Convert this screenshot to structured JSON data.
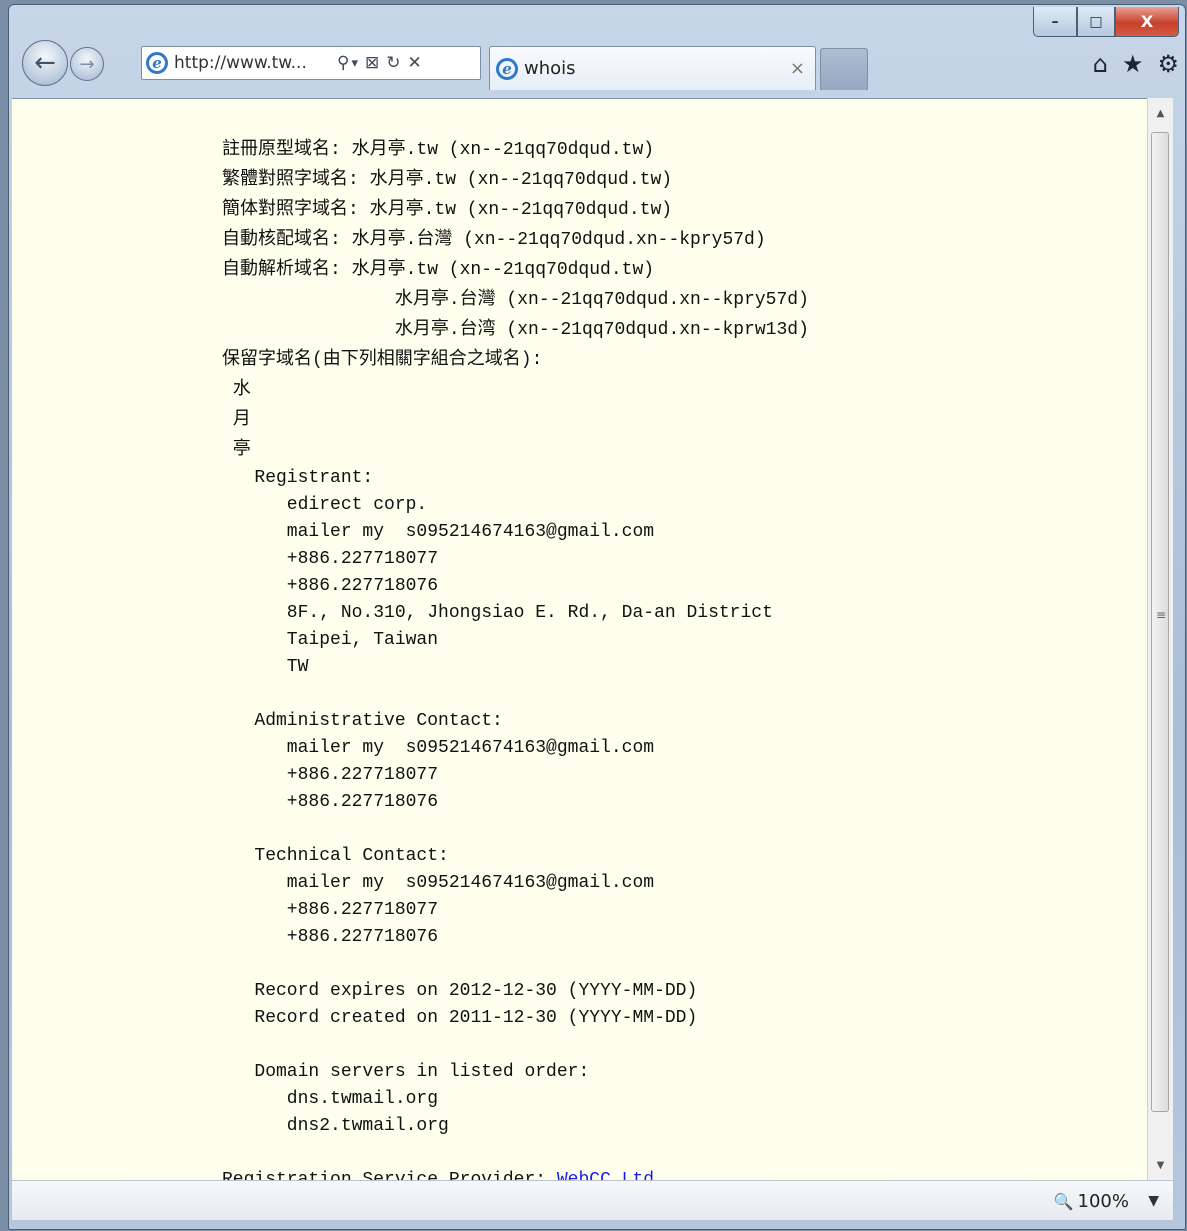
{
  "window": {
    "controls": {
      "minimize": "–",
      "maximize": "□",
      "close": "X"
    }
  },
  "nav": {
    "back_icon": "←",
    "forward_icon": "→",
    "address": {
      "url": "http://www.tw...",
      "icons": [
        "search-icon",
        "dropdown-icon",
        "compat-icon",
        "refresh-icon",
        "stop-icon"
      ],
      "search_glyph": "⚲",
      "dropdown_glyph": "▾",
      "compat_glyph": "⊠",
      "refresh_glyph": "↻",
      "stop_glyph": "✕"
    },
    "tab": {
      "title": "whois",
      "close": "×"
    },
    "commands": {
      "home": "⌂",
      "favorites": "★",
      "tools": "⚙"
    }
  },
  "whois": {
    "lines": [
      "註冊原型域名: 水月亭.tw (xn--21qq70dqud.tw)",
      "繁體對照字域名: 水月亭.tw (xn--21qq70dqud.tw)",
      "簡体對照字域名: 水月亭.tw (xn--21qq70dqud.tw)",
      "自動核配域名: 水月亭.台灣 (xn--21qq70dqud.xn--kpry57d)",
      "自動解析域名: 水月亭.tw (xn--21qq70dqud.tw)",
      "                水月亭.台灣 (xn--21qq70dqud.xn--kpry57d)",
      "                水月亭.台湾 (xn--21qq70dqud.xn--kprw13d)",
      "保留字域名(由下列相關字組合之域名):",
      " 水",
      " 月",
      " 亭"
    ],
    "registrant_header": "   Registrant:",
    "registrant_lines": [
      "      edirect corp.",
      "      mailer my  s095214674163@gmail.com",
      "      +886.227718077",
      "      +886.227718076",
      "      8F., No.310, Jhongsiao E. Rd., Da-an District",
      "      Taipei, Taiwan",
      "      TW"
    ],
    "admin_header": "   Administrative Contact:",
    "admin_lines": [
      "      mailer my  s095214674163@gmail.com",
      "      +886.227718077",
      "      +886.227718076"
    ],
    "tech_header": "   Technical Contact:",
    "tech_lines": [
      "      mailer my  s095214674163@gmail.com",
      "      +886.227718077",
      "      +886.227718076"
    ],
    "record_expires": "   Record expires on 2012-12-30 (YYYY-MM-DD)",
    "record_created": "   Record created on 2011-12-30 (YYYY-MM-DD)",
    "dns_header": "   Domain servers in listed order:",
    "dns_lines": [
      "      dns.twmail.org",
      "      dns2.twmail.org"
    ],
    "provider_label": "Registration Service Provider: ",
    "provider_link": "WebCC Ltd."
  },
  "status": {
    "zoom": "100%",
    "zoom_icon": "🔍",
    "zoom_dropdown": "▼"
  }
}
